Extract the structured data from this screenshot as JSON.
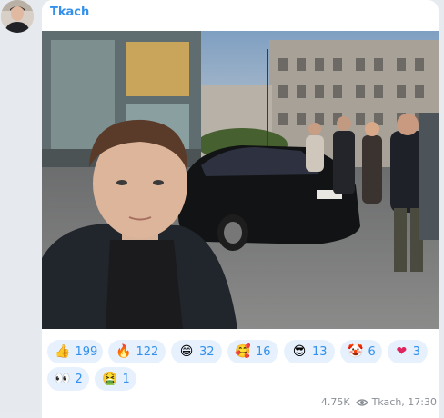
{
  "message": {
    "author": "Tkach",
    "views": "4.75K",
    "signature": "Tkach, 17:30",
    "reactions": [
      {
        "emoji_name": "thumbs-up",
        "glyph": "👍",
        "count": "199"
      },
      {
        "emoji_name": "fire",
        "glyph": "🔥",
        "count": "122"
      },
      {
        "emoji_name": "grinning-face",
        "glyph": "😁",
        "count": "32"
      },
      {
        "emoji_name": "smiling-face-with-hearts",
        "glyph": "🥰",
        "count": "16"
      },
      {
        "emoji_name": "sunglasses-face",
        "glyph": "😎",
        "count": "13"
      },
      {
        "emoji_name": "clown-face",
        "glyph": "🤡",
        "count": "6"
      },
      {
        "emoji_name": "red-heart",
        "glyph": "❤",
        "count": "3"
      },
      {
        "emoji_name": "eyes",
        "glyph": "👀",
        "count": "2"
      },
      {
        "emoji_name": "nauseated-face",
        "glyph": "🤮",
        "count": "1"
      }
    ]
  },
  "colors": {
    "accent": "#3390ec",
    "reaction_bg": "#e6f1fd",
    "chat_bg": "#e7ebf0",
    "meta_text": "#8a8f95"
  }
}
